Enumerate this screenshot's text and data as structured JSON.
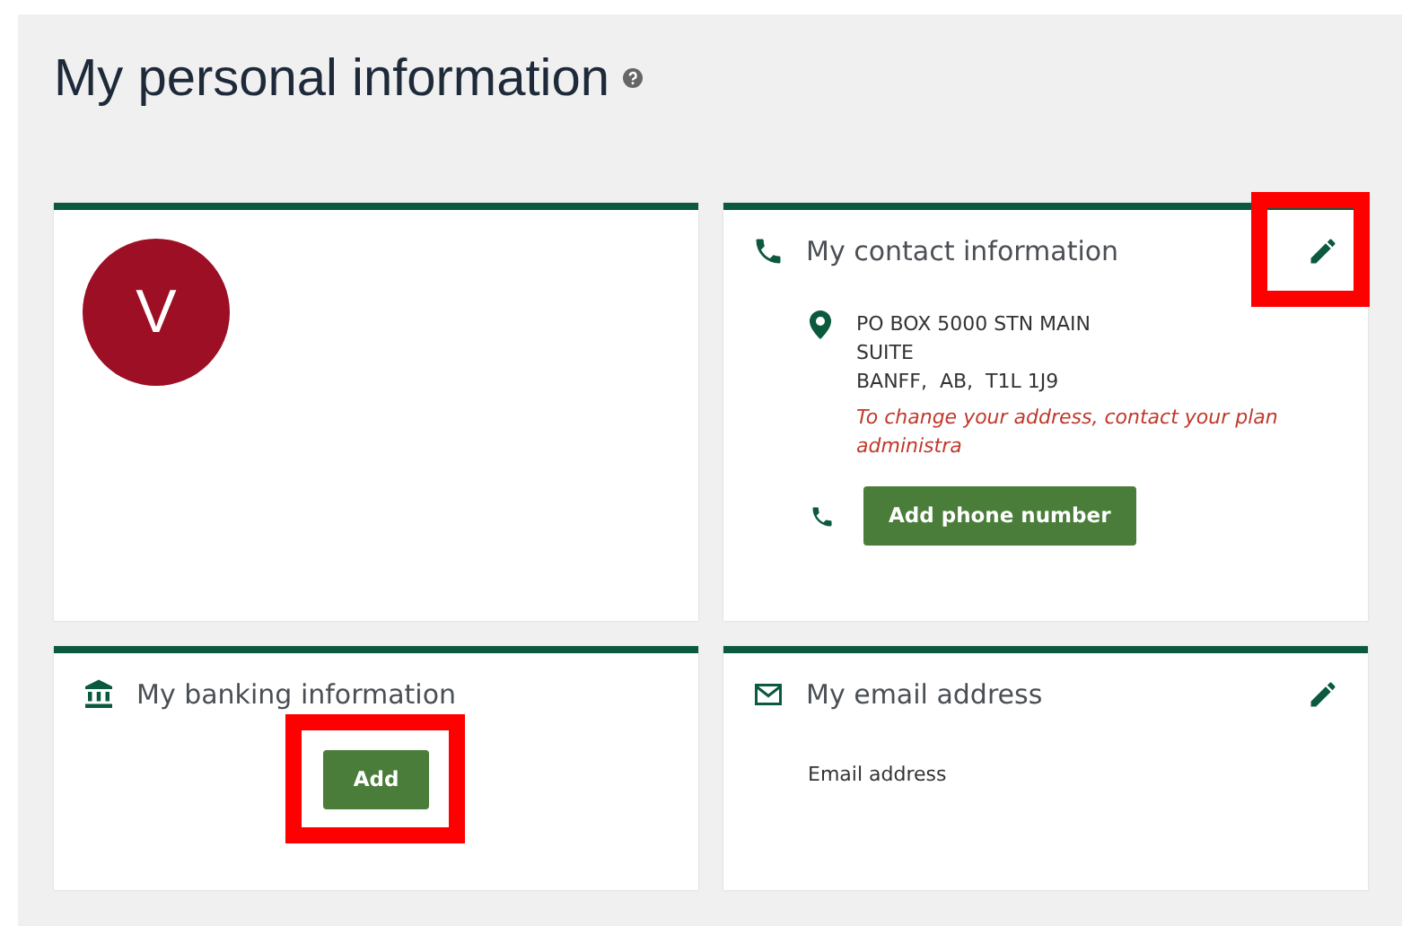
{
  "page": {
    "title": "My personal information"
  },
  "profile": {
    "initial": "V"
  },
  "contact": {
    "title": "My contact information",
    "edit_highlighted": true,
    "address_lines": [
      "PO BOX 5000 STN MAIN",
      "SUITE",
      "BANFF,  AB,  T1L 1J9"
    ],
    "note": "To change your address, contact your plan administra",
    "phone_button": "Add phone number"
  },
  "banking": {
    "title": "My banking information",
    "add_button": "Add",
    "add_highlighted": true
  },
  "email": {
    "title": "My email address",
    "label": "Email address"
  }
}
